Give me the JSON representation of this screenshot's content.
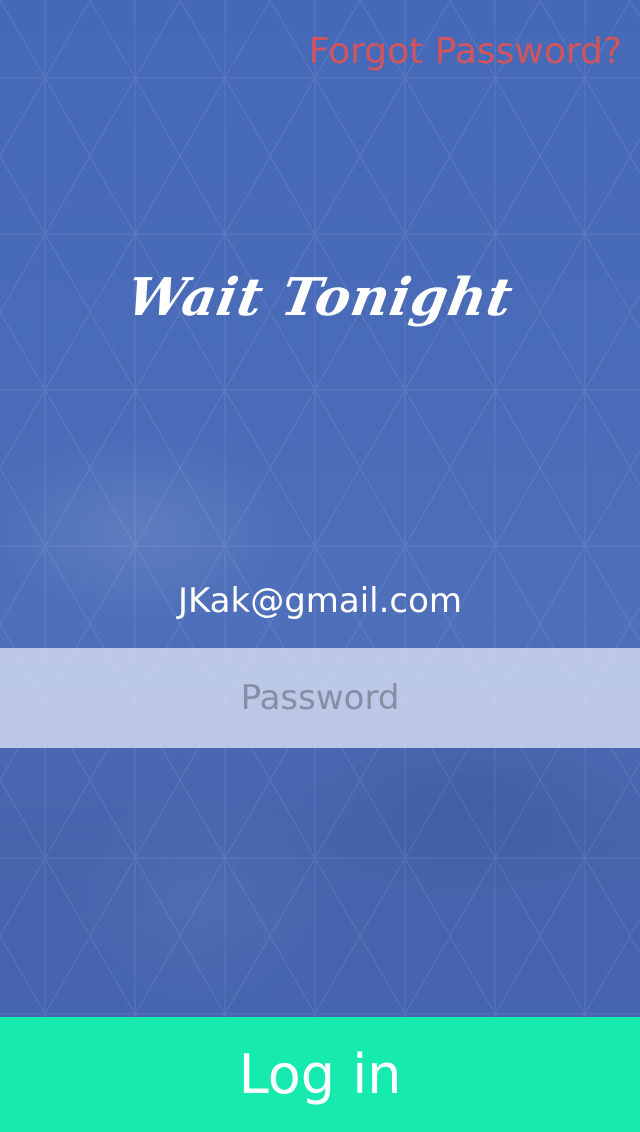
{
  "header": {
    "forgot_password_label": "Forgot Password?"
  },
  "logo": {
    "text": "Wait Tonight"
  },
  "form": {
    "email_value": "JKak@gmail.com",
    "password_placeholder": "Password",
    "login_label": "Log in"
  },
  "colors": {
    "background": "#4a6cb8",
    "forgot_link": "#d2555e",
    "login_button": "#16eaae",
    "password_field_bg": "#c7d0ec"
  }
}
